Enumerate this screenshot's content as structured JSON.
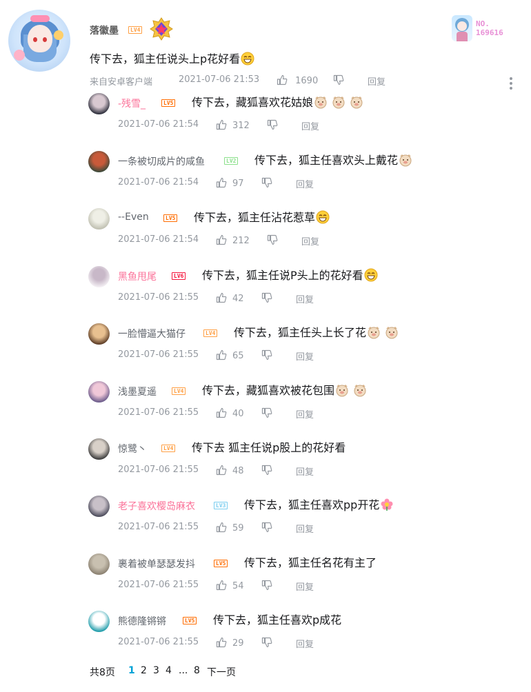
{
  "main_comment": {
    "username": "落徽墨",
    "level": "LV4",
    "level_color": "#ff9f43",
    "text": "传下去，狐主任说头上p花好看",
    "source": "来自安卓客户端",
    "timestamp": "2021-07-06 21:53",
    "likes": "1690",
    "reply_label": "回复",
    "medal_icon": "star-medal-icon",
    "nameplate": {
      "line1": "NO.",
      "line2": "169616",
      "color": "#e890d6"
    }
  },
  "replies": [
    {
      "username": "-残雪_",
      "name_color": "pink",
      "level": "LV5",
      "level_color": "#ff6c00",
      "text": "传下去，藏狐喜欢花姑娘",
      "emojis": [
        "dog-face-icon",
        "dog-face-icon",
        "dog-face-icon"
      ],
      "timestamp": "2021-07-06 21:54",
      "likes": "312",
      "reply_label": "回复"
    },
    {
      "username": "一条被切成片的咸鱼",
      "name_color": "plain",
      "level": "LV2",
      "level_color": "#8be08b",
      "text": "传下去，狐主任喜欢头上戴花",
      "emojis": [
        "dog-face-icon"
      ],
      "timestamp": "2021-07-06 21:54",
      "likes": "97",
      "reply_label": "回复"
    },
    {
      "username": "--Even",
      "name_color": "plain",
      "level": "LV5",
      "level_color": "#ff6c00",
      "text": "传下去，狐主任沾花惹草",
      "emojis": [
        "grin-face-icon"
      ],
      "timestamp": "2021-07-06 21:54",
      "likes": "212",
      "reply_label": "回复"
    },
    {
      "username": "黑鱼甩尾",
      "name_color": "pink",
      "level": "LV6",
      "level_color": "#f4143b",
      "text": "传下去，狐主任说P头上的花好看",
      "emojis": [
        "grin-face-icon"
      ],
      "timestamp": "2021-07-06 21:55",
      "likes": "42",
      "reply_label": "回复"
    },
    {
      "username": "一脸懵逼大猫仔",
      "name_color": "plain",
      "level": "LV4",
      "level_color": "#ff9f43",
      "text": "传下去，狐主任头上长了花",
      "emojis": [
        "dog-face-icon",
        "dog-face-icon"
      ],
      "timestamp": "2021-07-06 21:55",
      "likes": "65",
      "reply_label": "回复"
    },
    {
      "username": "浅墨夏遥",
      "name_color": "plain",
      "level": "LV4",
      "level_color": "#ff9f43",
      "text": "传下去，藏狐喜欢被花包围",
      "emojis": [
        "dog-face-icon",
        "dog-face-icon"
      ],
      "timestamp": "2021-07-06 21:55",
      "likes": "40",
      "reply_label": "回复"
    },
    {
      "username": "惊鹭丶",
      "name_color": "plain",
      "level": "LV4",
      "level_color": "#ff9f43",
      "text": "传下去 狐主任说p股上的花好看",
      "emojis": [],
      "timestamp": "2021-07-06 21:55",
      "likes": "48",
      "reply_label": "回复"
    },
    {
      "username": "老子喜欢樱岛麻衣",
      "name_color": "pink",
      "level": "LV3",
      "level_color": "#7bcdef",
      "text": "传下去，狐主任喜欢pp开花",
      "emojis": [
        "flower-icon"
      ],
      "timestamp": "2021-07-06 21:55",
      "likes": "59",
      "reply_label": "回复"
    },
    {
      "username": "裹着被单瑟瑟发抖",
      "name_color": "plain",
      "level": "LV5",
      "level_color": "#ff6c00",
      "text": "传下去，狐主任名花有主了",
      "emojis": [],
      "timestamp": "2021-07-06 21:55",
      "likes": "54",
      "reply_label": "回复"
    },
    {
      "username": "熊德隆锵锵",
      "name_color": "plain",
      "level": "LV5",
      "level_color": "#ff6c00",
      "text": "传下去，狐主任喜欢p成花",
      "emojis": [],
      "timestamp": "2021-07-06 21:55",
      "likes": "29",
      "reply_label": "回复"
    }
  ],
  "pagination": {
    "total": "共8页",
    "pages": [
      "1",
      "2",
      "3",
      "4",
      "...",
      "8"
    ],
    "current": "1",
    "next": "下一页"
  }
}
